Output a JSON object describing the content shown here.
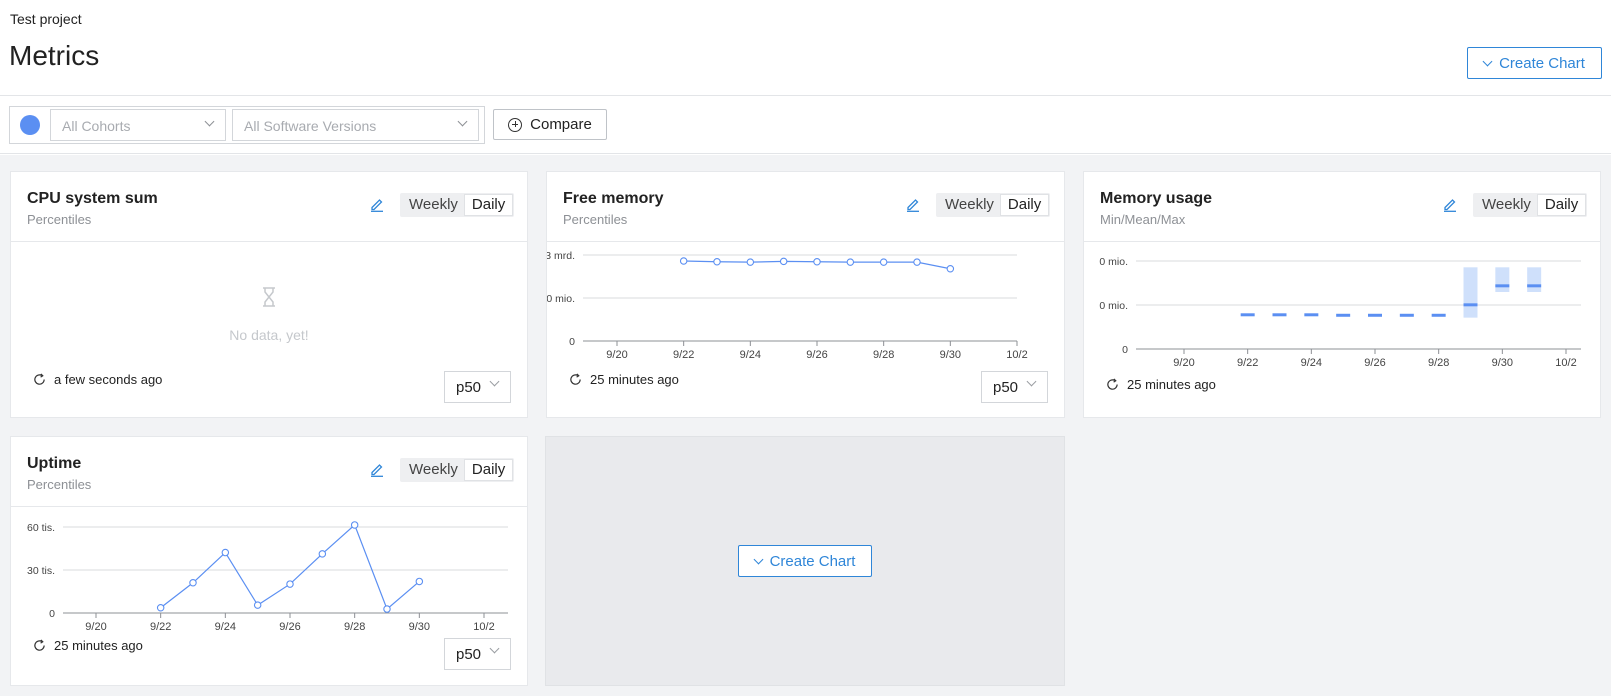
{
  "header": {
    "project": "Test project",
    "title": "Metrics",
    "create_chart_label": "Create Chart"
  },
  "filters": {
    "cohorts_placeholder": "All Cohorts",
    "versions_placeholder": "All Software Versions",
    "compare_label": "Compare",
    "dot_color": "#5b8ff2"
  },
  "colors": {
    "accent": "#2f86d8",
    "series": "#5b8ff2"
  },
  "toggle": {
    "weekly": "Weekly",
    "daily": "Daily",
    "active": "Daily"
  },
  "cards": [
    {
      "title": "CPU system sum",
      "subtitle": "Percentiles",
      "empty_message": "No data, yet!",
      "refreshed": "a few seconds ago",
      "percentile": "p50"
    },
    {
      "title": "Free memory",
      "subtitle": "Percentiles",
      "refreshed": "25 minutes ago",
      "percentile": "p50"
    },
    {
      "title": "Memory usage",
      "subtitle": "Min/Mean/Max",
      "refreshed": "25 minutes ago"
    },
    {
      "title": "Uptime",
      "subtitle": "Percentiles",
      "refreshed": "25 minutes ago",
      "percentile": "p50"
    }
  ],
  "empty_slot": {
    "create_chart_label": "Create Chart"
  },
  "chart_data": [
    {
      "type": "line",
      "title": "Free memory",
      "x": [
        "9/22",
        "9/23",
        "9/24",
        "9/25",
        "9/26",
        "9/27",
        "9/28",
        "9/29",
        "9/30"
      ],
      "x_ticks": [
        "9/20",
        "9/22",
        "9/24",
        "9/26",
        "9/28",
        "9/30",
        "10/2"
      ],
      "y_ticks": [
        "0",
        "0 mio.",
        "3 mrd."
      ],
      "series": [
        {
          "values": [
            1.98,
            1.96,
            1.95,
            1.97,
            1.96,
            1.95,
            1.95,
            1.95,
            1.78
          ]
        }
      ],
      "ylim": [
        0,
        2.1
      ],
      "y_unit": "mrd.",
      "grid": true
    },
    {
      "type": "bar",
      "title": "Memory usage",
      "x": [
        "9/22",
        "9/23",
        "9/24",
        "9/25",
        "9/26",
        "9/27",
        "9/28",
        "9/29",
        "9/30",
        "10/1"
      ],
      "x_ticks": [
        "9/20",
        "9/22",
        "9/24",
        "9/26",
        "9/28",
        "9/30",
        "10/2"
      ],
      "y_ticks": [
        "0",
        "0 mio.",
        "0 mio."
      ],
      "mean": [
        0.72,
        0.72,
        0.72,
        0.71,
        0.71,
        0.71,
        0.71,
        0.93,
        1.33,
        1.33
      ],
      "min": [
        0.72,
        0.72,
        0.72,
        0.71,
        0.71,
        0.71,
        0.71,
        0.66,
        1.2,
        1.2
      ],
      "max": [
        0.72,
        0.72,
        0.72,
        0.71,
        0.71,
        0.71,
        0.71,
        1.72,
        1.72,
        1.72
      ],
      "ylim": [
        0,
        2.0
      ],
      "grid": true
    },
    {
      "type": "line",
      "title": "Uptime",
      "x": [
        "9/22",
        "9/23",
        "9/24",
        "9/25",
        "9/26",
        "9/27",
        "9/28",
        "9/29",
        "9/30"
      ],
      "x_ticks": [
        "9/20",
        "9/22",
        "9/24",
        "9/26",
        "9/28",
        "9/30",
        "10/2"
      ],
      "y_ticks": [
        "0",
        "30 tis.",
        "60 tis."
      ],
      "series": [
        {
          "values": [
            4,
            23,
            46,
            6,
            22,
            45,
            67,
            3,
            24
          ]
        }
      ],
      "ylim": [
        0,
        70
      ],
      "y_unit": "tis.",
      "grid": true
    }
  ]
}
